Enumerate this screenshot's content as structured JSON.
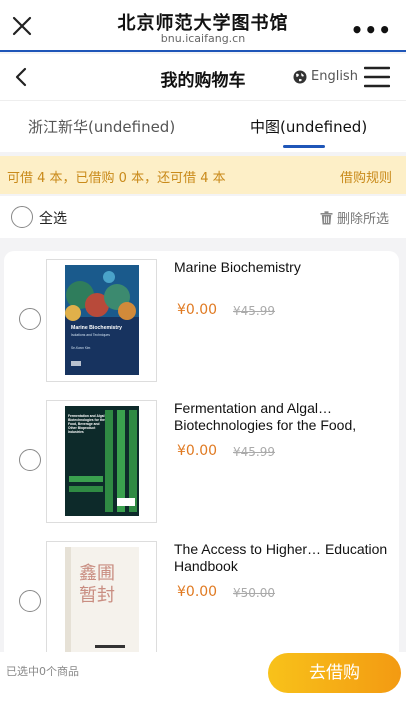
{
  "browser": {
    "title": "北京师范大学图书馆",
    "url": "bnu.icaifang.cn",
    "more_label": "•••"
  },
  "header": {
    "title": "我的购物车",
    "language": "English"
  },
  "tabs": [
    {
      "label": "浙江新华(undefined)",
      "active": false
    },
    {
      "label": "中图(undefined)",
      "active": true
    }
  ],
  "notice": {
    "text": "可借 4 本，已借购 0 本，还可借 4 本",
    "rules_label": "借购规则"
  },
  "select_all": {
    "label": "全选",
    "delete_label": "删除所选"
  },
  "items": [
    {
      "title": "Marine Biochemistry",
      "price": "¥0.00",
      "original_price": "¥45.99"
    },
    {
      "title": "Fermentation and Algal… Biotechnologies for the Food,",
      "price": "¥0.00",
      "original_price": "¥45.99"
    },
    {
      "title": "The Access to Higher… Education Handbook",
      "price": "¥0.00",
      "original_price": "¥50.00"
    }
  ],
  "covers": [
    {
      "title": "Marine Biochemistry",
      "subtitle": "Isolations and Techniques",
      "author": "Se-Kwon Kim"
    },
    {
      "title": "Fermentation and Algal Biotechnologies for the Food, Beverage and Other Bioproduct Industries"
    },
    {
      "title": "鑫圃 暂封"
    }
  ],
  "footer": {
    "selected_count": "已选中0个商品",
    "checkout_label": "去借购"
  },
  "colors": {
    "accent_blue": "#1f56b8",
    "price_orange": "#e07a22",
    "notice_bg": "#fdefc7",
    "notice_text": "#c98a1a",
    "button_gradient_start": "#f8c21a",
    "button_gradient_end": "#f39a12"
  }
}
